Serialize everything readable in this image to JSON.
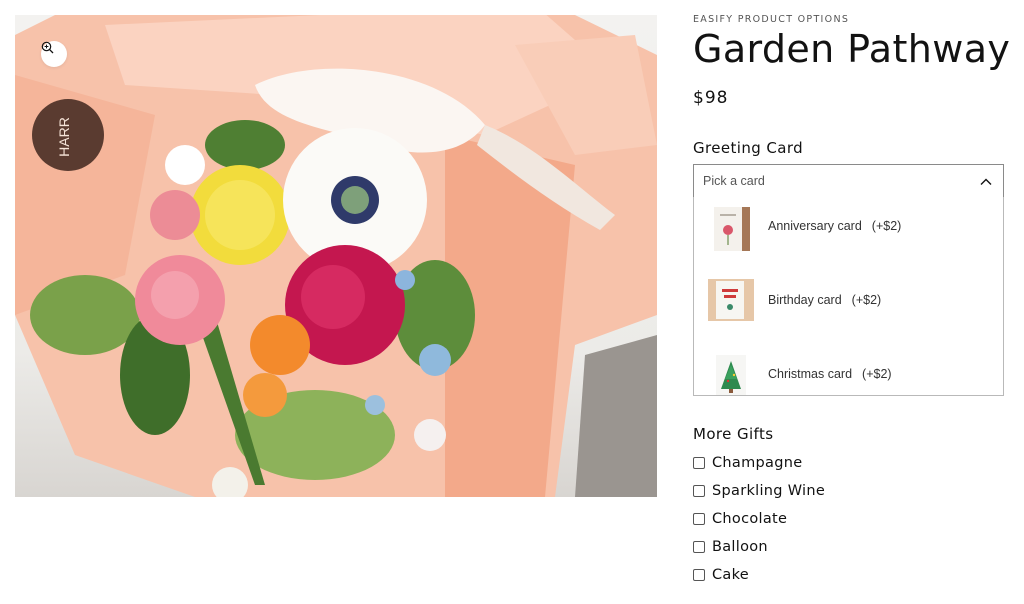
{
  "product": {
    "vendor": "EASIFY PRODUCT OPTIONS",
    "title": "Garden Pathway",
    "price": "$98"
  },
  "media": {
    "zoom_icon": "zoom-in-icon",
    "image_subject": "flower-bouquet",
    "wrap_label": "HARR"
  },
  "greeting_card": {
    "label": "Greeting Card",
    "placeholder": "Pick a card",
    "chevron_icon": "chevron-up-icon",
    "options": [
      {
        "name": "Anniversary card",
        "price": "(+$2)"
      },
      {
        "name": "Birthday card",
        "price": "(+$2)"
      },
      {
        "name": "Christmas card",
        "price": "(+$2)"
      }
    ]
  },
  "more_gifts": {
    "label": "More Gifts",
    "items": [
      {
        "label": "Champagne",
        "checked": false
      },
      {
        "label": "Sparkling Wine",
        "checked": false
      },
      {
        "label": "Chocolate",
        "checked": false
      },
      {
        "label": "Balloon",
        "checked": false
      },
      {
        "label": "Cake",
        "checked": false
      }
    ]
  },
  "colors": {
    "text": "#121212",
    "wrap_peach": "#f6b9a0",
    "border": "#8a8a8a"
  }
}
